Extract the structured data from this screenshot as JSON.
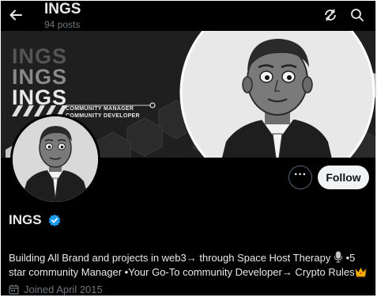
{
  "header": {
    "title": "INGS",
    "posts_count": "94 posts"
  },
  "banner": {
    "words": [
      "INGS",
      "INGS",
      "INGS"
    ],
    "role_line_1": "COMMUNITY MANAGER",
    "role_line_2": "COMMUNITY DEVELOPER"
  },
  "actions": {
    "more_label": "···",
    "follow_label": "Follow"
  },
  "profile": {
    "name": "INGS",
    "bio_part1": "Building All Brand and projects in web3→ through Space Host Therapy ",
    "bio_part2": " •5 star community Manager •Your Go-To community Developer→ Crypto Rules",
    "joined": "Joined April 2015"
  },
  "colors": {
    "background": "#000000",
    "text_primary": "#e7e9ea",
    "text_secondary": "#71767b",
    "verified_blue": "#1d9bf0",
    "follow_bg": "#eff3f4"
  },
  "icons": [
    "back-arrow-icon",
    "sync-icon",
    "search-icon",
    "verified-icon",
    "microphone-icon",
    "crown-icon",
    "calendar-icon",
    "more-icon"
  ]
}
